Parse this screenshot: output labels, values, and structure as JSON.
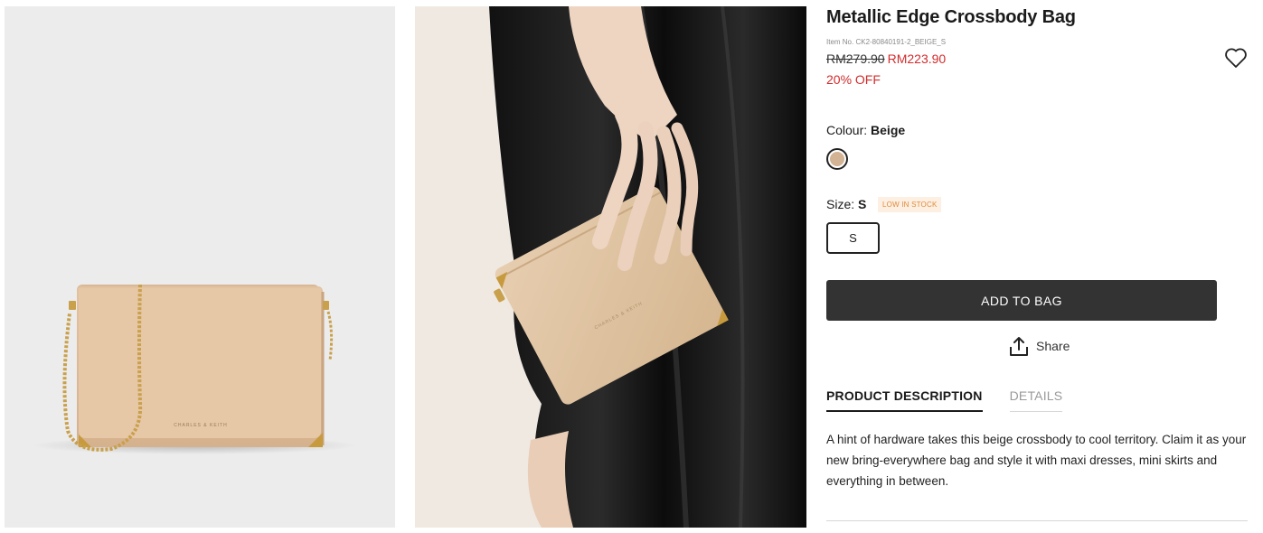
{
  "product": {
    "title": "Metallic Edge Crossbody Bag",
    "item_no": "Item No. CK2-80840191-2_BEIGE_S",
    "old_price": "RM279.90",
    "new_price": "RM223.90",
    "discount": "20% OFF"
  },
  "colour": {
    "label": "Colour:",
    "value": "Beige",
    "swatch_color": "#d2b393"
  },
  "size": {
    "label": "Size:",
    "value": "S",
    "stock_badge": "LOW IN STOCK",
    "options": [
      "S"
    ]
  },
  "actions": {
    "add_to_bag": "ADD TO BAG",
    "share": "Share"
  },
  "tabs": [
    {
      "label": "PRODUCT DESCRIPTION",
      "active": true
    },
    {
      "label": "DETAILS",
      "active": false
    }
  ],
  "description": "A hint of hardware takes this beige crossbody to cool territory. Claim it as your new bring-everywhere bag and style it with maxi dresses, mini skirts and everything in between.",
  "images": [
    {
      "name": "product-front-image",
      "brand_stamp": "CHARLES & KEITH"
    },
    {
      "name": "product-model-image",
      "brand_stamp": "CHARLES & KEITH"
    }
  ],
  "colors": {
    "accent_red": "#d12b2b",
    "button_dark": "#333333",
    "stock_orange": "#e08a3b"
  }
}
